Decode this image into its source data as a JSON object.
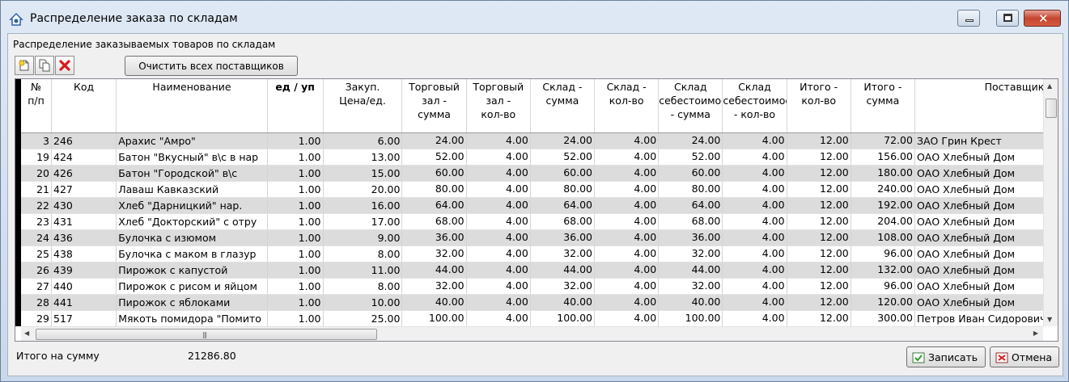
{
  "window": {
    "title": "Распределение заказа по складам"
  },
  "group_label": "Распределение заказываемых товаров по складам",
  "toolbar": {
    "clear_label": "Очистить всех поставщиков"
  },
  "columns": [
    {
      "l1": "№",
      "l2": "п/п",
      "l3": ""
    },
    {
      "l1": "Код",
      "l2": "",
      "l3": ""
    },
    {
      "l1": "Наименование",
      "l2": "",
      "l3": ""
    },
    {
      "l1": "ед / уп",
      "l2": "",
      "l3": ""
    },
    {
      "l1": "Закуп.",
      "l2": "Цена/ед.",
      "l3": ""
    },
    {
      "l1": "Торговый",
      "l2": "зал -",
      "l3": "сумма"
    },
    {
      "l1": "Торговый",
      "l2": "зал -",
      "l3": "кол-во"
    },
    {
      "l1": "Склад -",
      "l2": "сумма",
      "l3": ""
    },
    {
      "l1": "Склад -",
      "l2": "кол-во",
      "l3": ""
    },
    {
      "l1": "Склад",
      "l2": "себестоимос",
      "l3": "- сумма"
    },
    {
      "l1": "Склад",
      "l2": "себестоимос",
      "l3": "- кол-во"
    },
    {
      "l1": "Итого -",
      "l2": "кол-во",
      "l3": ""
    },
    {
      "l1": "Итого -",
      "l2": "сумма",
      "l3": ""
    },
    {
      "l1": "Поставщик",
      "l2": "",
      "l3": ""
    }
  ],
  "rows": [
    {
      "n": "3",
      "code": "246",
      "name": "Арахис \"Амро\"",
      "unit": "1.00",
      "price": "6.00",
      "ts": "24.00",
      "tq": "4.00",
      "ss": "24.00",
      "sq": "4.00",
      "cs": "24.00",
      "cq": "4.00",
      "iq": "12.00",
      "is": "72.00",
      "sup": "ЗАО Грин Крест"
    },
    {
      "n": "19",
      "code": "424",
      "name": "Батон \"Вкусный\" в\\с в нар",
      "unit": "1.00",
      "price": "13.00",
      "ts": "52.00",
      "tq": "4.00",
      "ss": "52.00",
      "sq": "4.00",
      "cs": "52.00",
      "cq": "4.00",
      "iq": "12.00",
      "is": "156.00",
      "sup": "ОАО Хлебный Дом"
    },
    {
      "n": "20",
      "code": "426",
      "name": "Батон \"Городской\" в\\с",
      "unit": "1.00",
      "price": "15.00",
      "ts": "60.00",
      "tq": "4.00",
      "ss": "60.00",
      "sq": "4.00",
      "cs": "60.00",
      "cq": "4.00",
      "iq": "12.00",
      "is": "180.00",
      "sup": "ОАО Хлебный Дом"
    },
    {
      "n": "21",
      "code": "427",
      "name": "Лаваш Кавказский",
      "unit": "1.00",
      "price": "20.00",
      "ts": "80.00",
      "tq": "4.00",
      "ss": "80.00",
      "sq": "4.00",
      "cs": "80.00",
      "cq": "4.00",
      "iq": "12.00",
      "is": "240.00",
      "sup": "ОАО Хлебный Дом"
    },
    {
      "n": "22",
      "code": "430",
      "name": "Хлеб \"Дарницкий\" нар.",
      "unit": "1.00",
      "price": "16.00",
      "ts": "64.00",
      "tq": "4.00",
      "ss": "64.00",
      "sq": "4.00",
      "cs": "64.00",
      "cq": "4.00",
      "iq": "12.00",
      "is": "192.00",
      "sup": "ОАО Хлебный Дом"
    },
    {
      "n": "23",
      "code": "431",
      "name": "Хлеб \"Докторский\" с отру",
      "unit": "1.00",
      "price": "17.00",
      "ts": "68.00",
      "tq": "4.00",
      "ss": "68.00",
      "sq": "4.00",
      "cs": "68.00",
      "cq": "4.00",
      "iq": "12.00",
      "is": "204.00",
      "sup": "ОАО Хлебный Дом"
    },
    {
      "n": "24",
      "code": "436",
      "name": "Булочка с изюмом",
      "unit": "1.00",
      "price": "9.00",
      "ts": "36.00",
      "tq": "4.00",
      "ss": "36.00",
      "sq": "4.00",
      "cs": "36.00",
      "cq": "4.00",
      "iq": "12.00",
      "is": "108.00",
      "sup": "ОАО Хлебный Дом"
    },
    {
      "n": "25",
      "code": "438",
      "name": "Булочка с маком в глазур",
      "unit": "1.00",
      "price": "8.00",
      "ts": "32.00",
      "tq": "4.00",
      "ss": "32.00",
      "sq": "4.00",
      "cs": "32.00",
      "cq": "4.00",
      "iq": "12.00",
      "is": "96.00",
      "sup": "ОАО Хлебный Дом"
    },
    {
      "n": "26",
      "code": "439",
      "name": "Пирожок с капустой",
      "unit": "1.00",
      "price": "11.00",
      "ts": "44.00",
      "tq": "4.00",
      "ss": "44.00",
      "sq": "4.00",
      "cs": "44.00",
      "cq": "4.00",
      "iq": "12.00",
      "is": "132.00",
      "sup": "ОАО Хлебный Дом"
    },
    {
      "n": "27",
      "code": "440",
      "name": "Пирожок с рисом и яйцом",
      "unit": "1.00",
      "price": "8.00",
      "ts": "32.00",
      "tq": "4.00",
      "ss": "32.00",
      "sq": "4.00",
      "cs": "32.00",
      "cq": "4.00",
      "iq": "12.00",
      "is": "96.00",
      "sup": "ОАО Хлебный Дом"
    },
    {
      "n": "28",
      "code": "441",
      "name": "Пирожок с яблоками",
      "unit": "1.00",
      "price": "10.00",
      "ts": "40.00",
      "tq": "4.00",
      "ss": "40.00",
      "sq": "4.00",
      "cs": "40.00",
      "cq": "4.00",
      "iq": "12.00",
      "is": "120.00",
      "sup": "ОАО Хлебный Дом"
    },
    {
      "n": "29",
      "code": "517",
      "name": "Мякоть помидора \"Помито",
      "unit": "1.00",
      "price": "25.00",
      "ts": "100.00",
      "tq": "4.00",
      "ss": "100.00",
      "sq": "4.00",
      "cs": "100.00",
      "cq": "4.00",
      "iq": "12.00",
      "is": "300.00",
      "sup": "Петров Иван Сидорович"
    }
  ],
  "footer": {
    "total_label": "Итого на сумму",
    "total_value": "21286.80",
    "save_label": "Записать",
    "cancel_label": "Отмена"
  }
}
